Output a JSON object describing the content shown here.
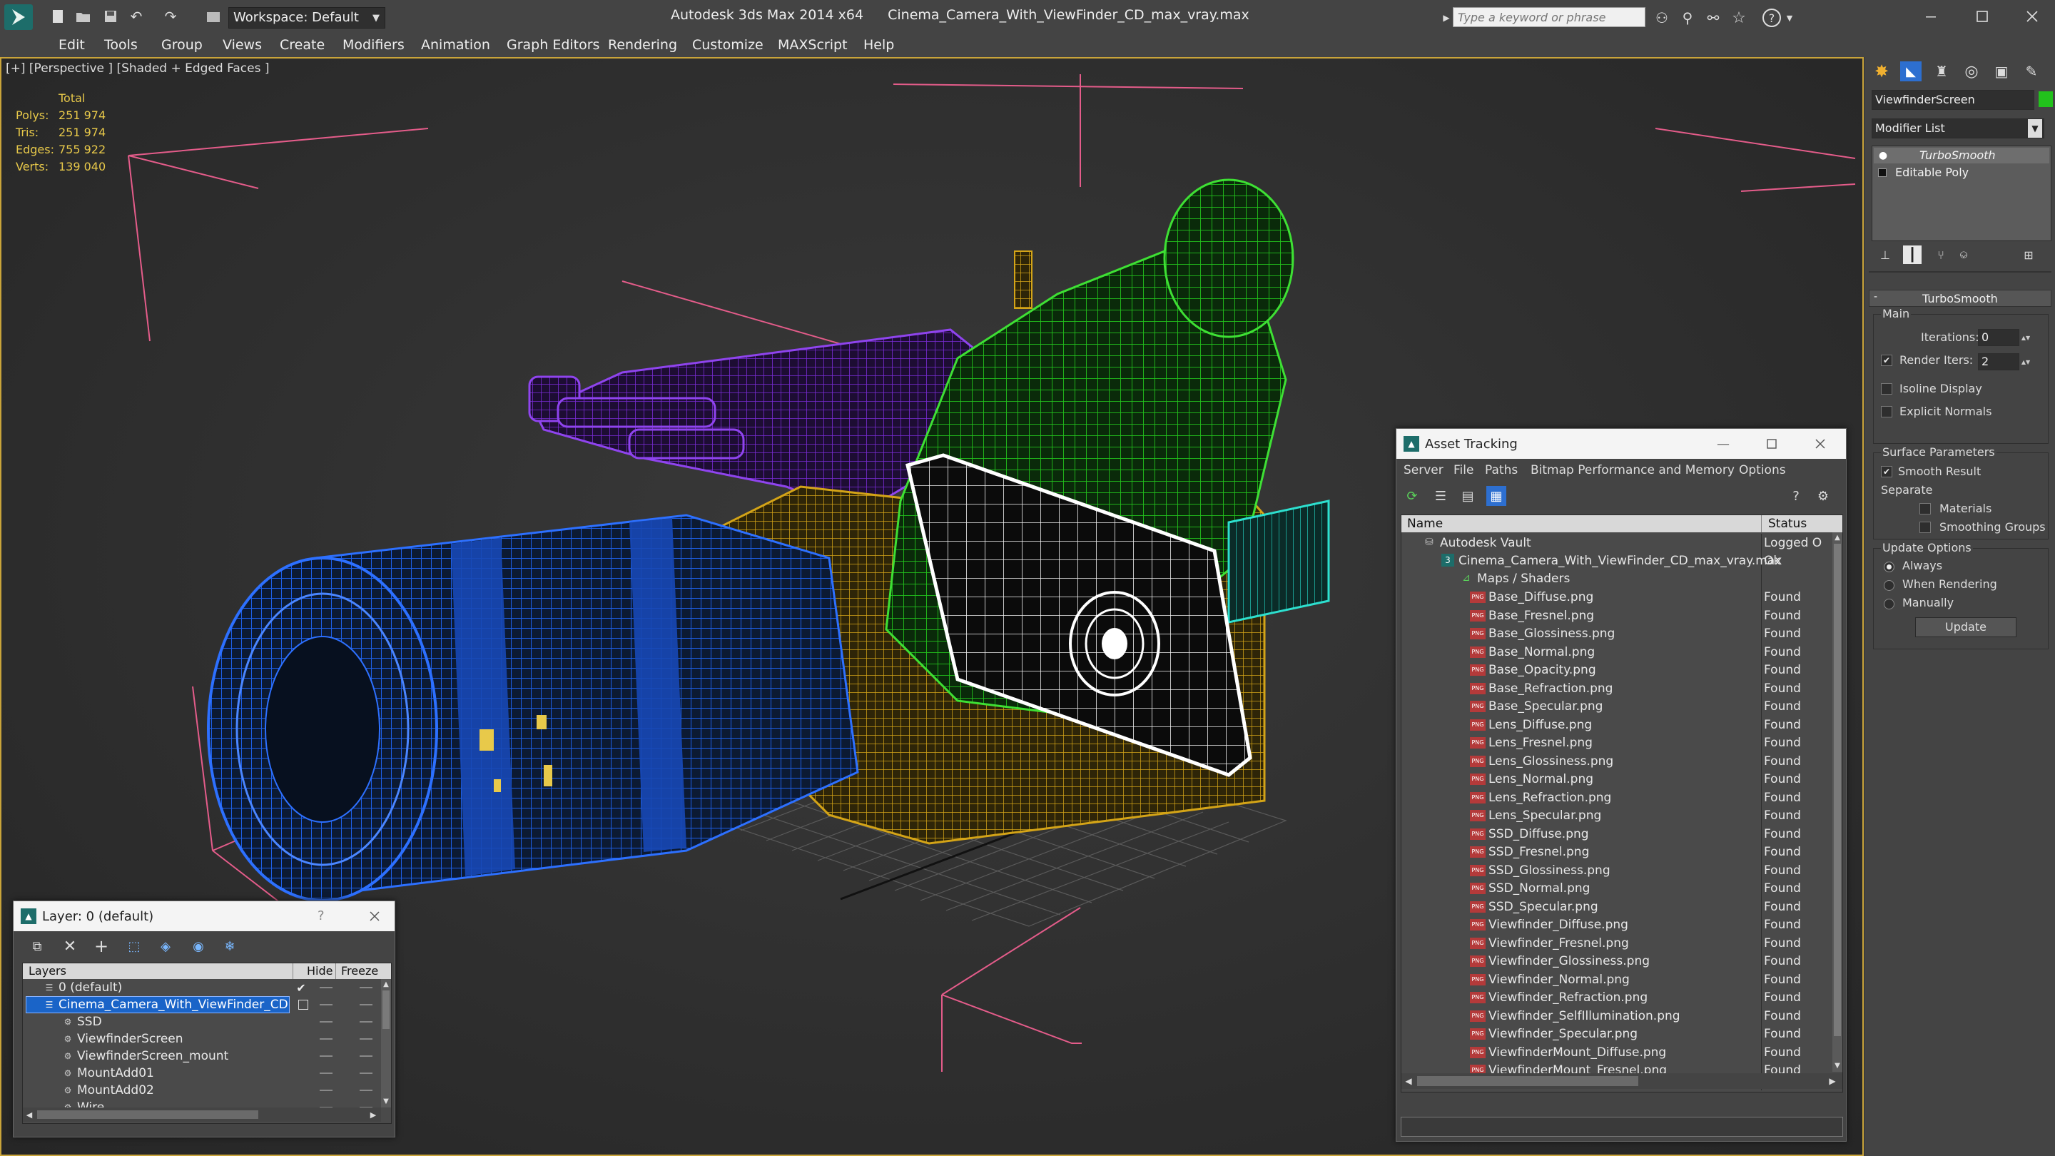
{
  "app": {
    "title": "Autodesk 3ds Max  2014 x64",
    "file": "Cinema_Camera_With_ViewFinder_CD_max_vray.max",
    "workspace": "Workspace: Default",
    "search_placeholder": "Type a keyword or phrase"
  },
  "menu": [
    "Edit",
    "Tools",
    "Group",
    "Views",
    "Create",
    "Modifiers",
    "Animation",
    "Graph Editors",
    "Rendering",
    "Customize",
    "MAXScript",
    "Help"
  ],
  "viewport": {
    "label": "[+] [Perspective ] [Shaded + Edged Faces ]",
    "stats": {
      "header": "Total",
      "rows": [
        {
          "label": "Polys:",
          "value": "251 974"
        },
        {
          "label": "Tris:",
          "value": "251 974"
        },
        {
          "label": "Edges:",
          "value": "755 922"
        },
        {
          "label": "Verts:",
          "value": "139 040"
        }
      ]
    }
  },
  "command_panel": {
    "object_name": "ViewfinderScreen",
    "modifier_list": "Modifier List",
    "stack": [
      "TurboSmooth",
      "Editable Poly"
    ],
    "rollout_title": "TurboSmooth",
    "main_group": "Main",
    "iterations_label": "Iterations:",
    "iterations_value": "0",
    "render_iters_label": "Render Iters:",
    "render_iters_value": "2",
    "isoline": "Isoline Display",
    "explicit": "Explicit Normals",
    "surface_group": "Surface Parameters",
    "smooth_result": "Smooth Result",
    "separate": "Separate",
    "materials": "Materials",
    "smoothing_groups": "Smoothing Groups",
    "update_group": "Update Options",
    "always": "Always",
    "when_rendering": "When Rendering",
    "manually": "Manually",
    "update_button": "Update"
  },
  "asset_tracking": {
    "title": "Asset Tracking",
    "menu": [
      "Server",
      "File",
      "Paths",
      "Bitmap Performance and Memory",
      "Options"
    ],
    "col_name": "Name",
    "col_status": "Status",
    "vault": {
      "name": "Autodesk Vault",
      "status": "Logged O"
    },
    "file": {
      "name": "Cinema_Camera_With_ViewFinder_CD_max_vray.max",
      "status": "Ok"
    },
    "maps_folder": "Maps / Shaders",
    "png_tag": "PNG",
    "maps": [
      {
        "name": "Base_Diffuse.png",
        "status": "Found"
      },
      {
        "name": "Base_Fresnel.png",
        "status": "Found"
      },
      {
        "name": "Base_Glossiness.png",
        "status": "Found"
      },
      {
        "name": "Base_Normal.png",
        "status": "Found"
      },
      {
        "name": "Base_Opacity.png",
        "status": "Found"
      },
      {
        "name": "Base_Refraction.png",
        "status": "Found"
      },
      {
        "name": "Base_Specular.png",
        "status": "Found"
      },
      {
        "name": "Lens_Diffuse.png",
        "status": "Found"
      },
      {
        "name": "Lens_Fresnel.png",
        "status": "Found"
      },
      {
        "name": "Lens_Glossiness.png",
        "status": "Found"
      },
      {
        "name": "Lens_Normal.png",
        "status": "Found"
      },
      {
        "name": "Lens_Refraction.png",
        "status": "Found"
      },
      {
        "name": "Lens_Specular.png",
        "status": "Found"
      },
      {
        "name": "SSD_Diffuse.png",
        "status": "Found"
      },
      {
        "name": "SSD_Fresnel.png",
        "status": "Found"
      },
      {
        "name": "SSD_Glossiness.png",
        "status": "Found"
      },
      {
        "name": "SSD_Normal.png",
        "status": "Found"
      },
      {
        "name": "SSD_Specular.png",
        "status": "Found"
      },
      {
        "name": "Viewfinder_Diffuse.png",
        "status": "Found"
      },
      {
        "name": "Viewfinder_Fresnel.png",
        "status": "Found"
      },
      {
        "name": "Viewfinder_Glossiness.png",
        "status": "Found"
      },
      {
        "name": "Viewfinder_Normal.png",
        "status": "Found"
      },
      {
        "name": "Viewfinder_Refraction.png",
        "status": "Found"
      },
      {
        "name": "Viewfinder_SelfIllumination.png",
        "status": "Found"
      },
      {
        "name": "Viewfinder_Specular.png",
        "status": "Found"
      },
      {
        "name": "ViewfinderMount_Diffuse.png",
        "status": "Found"
      },
      {
        "name": "ViewfinderMount_Fresnel.png",
        "status": "Found"
      }
    ]
  },
  "layer_dialog": {
    "title": "Layer: 0 (default)",
    "help": "?",
    "col_layers": "Layers",
    "col_hide": "Hide",
    "col_freeze": "Freeze",
    "layers": [
      {
        "name": "0 (default)"
      },
      {
        "name": "Cinema_Camera_With_ViewFinder_CD"
      }
    ],
    "objects": [
      "SSD",
      "ViewfinderScreen",
      "ViewfinderScreen_mount",
      "MountAdd01",
      "MountAdd02",
      "Wire"
    ]
  },
  "colors": {
    "lens": "#1e5fe6",
    "body": "#d4a417",
    "handle": "#7a2cd6",
    "viewfinder": "#22c21c",
    "screen": "#f2f2f2",
    "ssd": "#1fb7a8",
    "selection": "#1a64c8",
    "accent": "#e8c94a"
  }
}
